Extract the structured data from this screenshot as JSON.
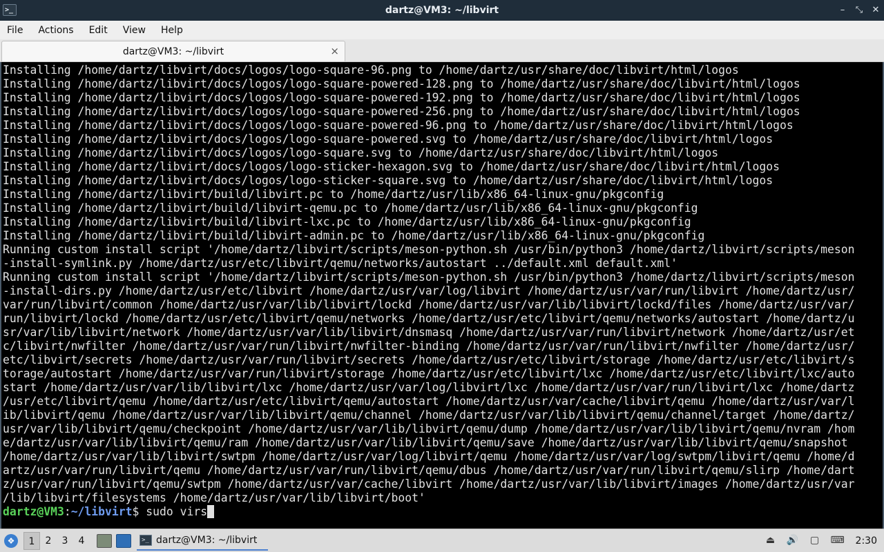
{
  "window": {
    "title": "dartz@VM3: ~/libvirt",
    "app_icon": ">_",
    "controls": [
      "–",
      "⤡",
      "✕"
    ]
  },
  "menu": {
    "items": [
      "File",
      "Actions",
      "Edit",
      "View",
      "Help"
    ]
  },
  "tabs": [
    {
      "label": "dartz@VM3: ~/libvirt",
      "close": "×"
    }
  ],
  "terminal": {
    "lines": [
      "Installing /home/dartz/libvirt/docs/logos/logo-square-96.png to /home/dartz/usr/share/doc/libvirt/html/logos",
      "Installing /home/dartz/libvirt/docs/logos/logo-square-powered-128.png to /home/dartz/usr/share/doc/libvirt/html/logos",
      "Installing /home/dartz/libvirt/docs/logos/logo-square-powered-192.png to /home/dartz/usr/share/doc/libvirt/html/logos",
      "Installing /home/dartz/libvirt/docs/logos/logo-square-powered-256.png to /home/dartz/usr/share/doc/libvirt/html/logos",
      "Installing /home/dartz/libvirt/docs/logos/logo-square-powered-96.png to /home/dartz/usr/share/doc/libvirt/html/logos",
      "Installing /home/dartz/libvirt/docs/logos/logo-square-powered.svg to /home/dartz/usr/share/doc/libvirt/html/logos",
      "Installing /home/dartz/libvirt/docs/logos/logo-square.svg to /home/dartz/usr/share/doc/libvirt/html/logos",
      "Installing /home/dartz/libvirt/docs/logos/logo-sticker-hexagon.svg to /home/dartz/usr/share/doc/libvirt/html/logos",
      "Installing /home/dartz/libvirt/docs/logos/logo-sticker-square.svg to /home/dartz/usr/share/doc/libvirt/html/logos",
      "Installing /home/dartz/libvirt/build/libvirt.pc to /home/dartz/usr/lib/x86_64-linux-gnu/pkgconfig",
      "Installing /home/dartz/libvirt/build/libvirt-qemu.pc to /home/dartz/usr/lib/x86_64-linux-gnu/pkgconfig",
      "Installing /home/dartz/libvirt/build/libvirt-lxc.pc to /home/dartz/usr/lib/x86_64-linux-gnu/pkgconfig",
      "Installing /home/dartz/libvirt/build/libvirt-admin.pc to /home/dartz/usr/lib/x86_64-linux-gnu/pkgconfig",
      "Running custom install script '/home/dartz/libvirt/scripts/meson-python.sh /usr/bin/python3 /home/dartz/libvirt/scripts/meson",
      "-install-symlink.py /home/dartz/usr/etc/libvirt/qemu/networks/autostart ../default.xml default.xml'",
      "Running custom install script '/home/dartz/libvirt/scripts/meson-python.sh /usr/bin/python3 /home/dartz/libvirt/scripts/meson",
      "-install-dirs.py /home/dartz/usr/etc/libvirt /home/dartz/usr/var/log/libvirt /home/dartz/usr/var/run/libvirt /home/dartz/usr/",
      "var/run/libvirt/common /home/dartz/usr/var/lib/libvirt/lockd /home/dartz/usr/var/lib/libvirt/lockd/files /home/dartz/usr/var/",
      "run/libvirt/lockd /home/dartz/usr/etc/libvirt/qemu/networks /home/dartz/usr/etc/libvirt/qemu/networks/autostart /home/dartz/u",
      "sr/var/lib/libvirt/network /home/dartz/usr/var/lib/libvirt/dnsmasq /home/dartz/usr/var/run/libvirt/network /home/dartz/usr/et",
      "c/libvirt/nwfilter /home/dartz/usr/var/run/libvirt/nwfilter-binding /home/dartz/usr/var/run/libvirt/nwfilter /home/dartz/usr/",
      "etc/libvirt/secrets /home/dartz/usr/var/run/libvirt/secrets /home/dartz/usr/etc/libvirt/storage /home/dartz/usr/etc/libvirt/s",
      "torage/autostart /home/dartz/usr/var/run/libvirt/storage /home/dartz/usr/etc/libvirt/lxc /home/dartz/usr/etc/libvirt/lxc/auto",
      "start /home/dartz/usr/var/lib/libvirt/lxc /home/dartz/usr/var/log/libvirt/lxc /home/dartz/usr/var/run/libvirt/lxc /home/dartz",
      "/usr/etc/libvirt/qemu /home/dartz/usr/etc/libvirt/qemu/autostart /home/dartz/usr/var/cache/libvirt/qemu /home/dartz/usr/var/l",
      "ib/libvirt/qemu /home/dartz/usr/var/lib/libvirt/qemu/channel /home/dartz/usr/var/lib/libvirt/qemu/channel/target /home/dartz/",
      "usr/var/lib/libvirt/qemu/checkpoint /home/dartz/usr/var/lib/libvirt/qemu/dump /home/dartz/usr/var/lib/libvirt/qemu/nvram /hom",
      "e/dartz/usr/var/lib/libvirt/qemu/ram /home/dartz/usr/var/lib/libvirt/qemu/save /home/dartz/usr/var/lib/libvirt/qemu/snapshot",
      "/home/dartz/usr/var/lib/libvirt/swtpm /home/dartz/usr/var/log/libvirt/qemu /home/dartz/usr/var/log/swtpm/libvirt/qemu /home/d",
      "artz/usr/var/run/libvirt/qemu /home/dartz/usr/var/run/libvirt/qemu/dbus /home/dartz/usr/var/run/libvirt/qemu/slirp /home/dart",
      "z/usr/var/run/libvirt/qemu/swtpm /home/dartz/usr/var/cache/libvirt /home/dartz/usr/var/lib/libvirt/images /home/dartz/usr/var",
      "/lib/libvirt/filesystems /home/dartz/usr/var/lib/libvirt/boot'"
    ],
    "prompt": {
      "user_host": "dartz@VM3",
      "sep": ":",
      "path": "~/libvirt",
      "symbol": "$ ",
      "command": "sudo virs"
    }
  },
  "taskbar": {
    "start_icon": "❖",
    "workspaces": [
      "1",
      "2",
      "3",
      "4"
    ],
    "task_label": "dartz@VM3: ~/libvirt",
    "term_icon": ">_",
    "tray": {
      "icons": [
        "⏏",
        "🔊",
        "▢",
        "⌨"
      ],
      "clock": "2:30"
    }
  }
}
